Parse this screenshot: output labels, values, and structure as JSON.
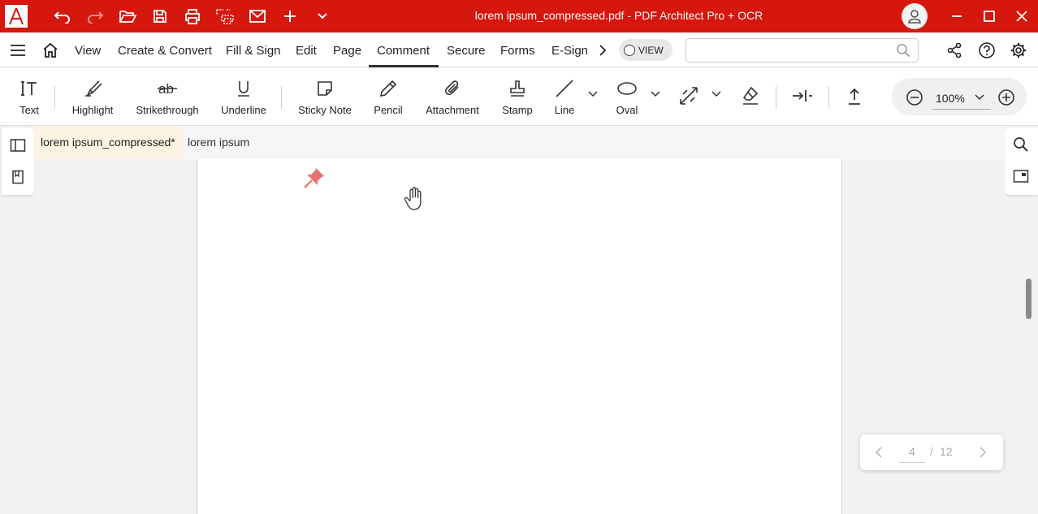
{
  "window": {
    "title": "lorem ipsum_compressed.pdf  -  PDF Architect Pro + OCR"
  },
  "menu": {
    "items": [
      "View",
      "Create & Convert",
      "Fill & Sign",
      "Edit",
      "Page",
      "Comment",
      "Secure",
      "Forms",
      "E-Sign"
    ],
    "active": "Comment",
    "view_toggle_label": "VIEW",
    "search_placeholder": ""
  },
  "ribbon": {
    "tools": {
      "text": "Text",
      "highlight": "Highlight",
      "strikethrough": "Strikethrough",
      "underline": "Underline",
      "sticky_note": "Sticky Note",
      "pencil": "Pencil",
      "attachment": "Attachment",
      "stamp": "Stamp",
      "line": "Line",
      "oval": "Oval"
    },
    "zoom_value": "100%"
  },
  "tabs": [
    {
      "label": "lorem ipsum_compressed*",
      "active": true
    },
    {
      "label": "lorem ipsum",
      "active": false
    }
  ],
  "pager": {
    "current": "4",
    "separator": "/",
    "total": "12"
  },
  "colors": {
    "brand": "#d5170d",
    "pin": "#e8736c",
    "active_tab": "#fdf3e2"
  }
}
